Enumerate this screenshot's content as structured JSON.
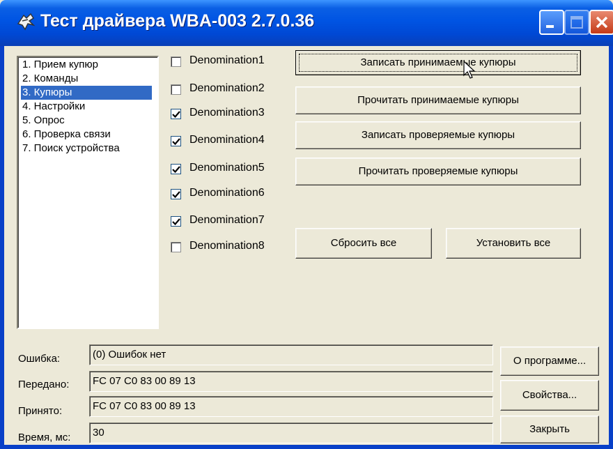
{
  "window": {
    "title": "Тест драйвера WBA-003 2.7.0.36"
  },
  "list": {
    "items": [
      {
        "label": "1. Прием купюр"
      },
      {
        "label": "2. Команды"
      },
      {
        "label": "3. Купюры"
      },
      {
        "label": "4. Настройки"
      },
      {
        "label": "5. Опрос"
      },
      {
        "label": "6. Проверка связи"
      },
      {
        "label": "7. Поиск устройства"
      }
    ],
    "selected_index": 2
  },
  "denominations": [
    {
      "label": "Denomination1",
      "checked": false
    },
    {
      "label": "Denomination2",
      "checked": false
    },
    {
      "label": "Denomination3",
      "checked": true
    },
    {
      "label": "Denomination4",
      "checked": true
    },
    {
      "label": "Denomination5",
      "checked": true
    },
    {
      "label": "Denomination6",
      "checked": true
    },
    {
      "label": "Denomination7",
      "checked": true
    },
    {
      "label": "Denomination8",
      "checked": false
    }
  ],
  "actions": {
    "write_accepted": "Записать принимаемые купюры",
    "read_accepted": "Прочитать принимаемые купюры",
    "write_checked": "Записать проверяемые купюры",
    "read_checked": "Прочитать проверяемые купюры",
    "reset_all": "Сбросить все",
    "set_all": "Установить все"
  },
  "status": {
    "error_label": "Ошибка:",
    "error_value": "(0) Ошибок нет",
    "sent_label": "Передано:",
    "sent_value": "FC 07 C0 83 00 89 13",
    "received_label": "Принято:",
    "received_value": "FC 07 C0 83 00 89 13",
    "time_label": "Время, мс:",
    "time_value": "30"
  },
  "side_buttons": {
    "about": "О программе...",
    "properties": "Свойства...",
    "close": "Закрыть"
  },
  "colors": {
    "titlebar": "#0054e3",
    "selection": "#316ac5",
    "face": "#ece9d8"
  }
}
